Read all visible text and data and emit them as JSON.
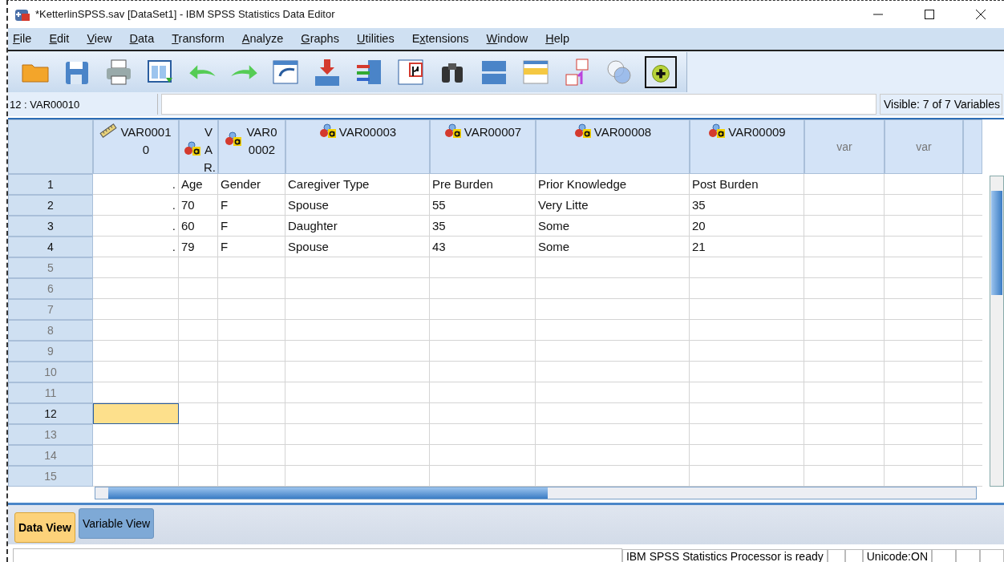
{
  "window": {
    "title": "*KetterlinSPSS.sav [DataSet1] - IBM SPSS Statistics Data Editor"
  },
  "menu": [
    {
      "mnemonic": "F",
      "rest": "ile"
    },
    {
      "mnemonic": "E",
      "rest": "dit"
    },
    {
      "mnemonic": "V",
      "rest": "iew"
    },
    {
      "mnemonic": "D",
      "rest": "ata"
    },
    {
      "mnemonic": "T",
      "rest": "ransform"
    },
    {
      "mnemonic": "A",
      "rest": "nalyze"
    },
    {
      "mnemonic": "G",
      "rest": "raphs"
    },
    {
      "mnemonic": "U",
      "rest": "tilities"
    },
    {
      "lead": "E",
      "mnemonic": "x",
      "rest": "tensions"
    },
    {
      "mnemonic": "W",
      "rest": "indow"
    },
    {
      "mnemonic": "H",
      "rest": "elp"
    }
  ],
  "cell_editor": {
    "cell_name": "12 : VAR00010",
    "visible": "Visible: 7 of 7 Variables"
  },
  "columns": [
    {
      "name": "VAR00010",
      "kind": "scale"
    },
    {
      "name": "VAR.",
      "kind": "nominal"
    },
    {
      "name": "VAR00002",
      "kind": "nominal"
    },
    {
      "name": "VAR00003",
      "kind": "nominal"
    },
    {
      "name": "VAR00007",
      "kind": "nominal"
    },
    {
      "name": "VAR00008",
      "kind": "nominal"
    },
    {
      "name": "VAR00009",
      "kind": "nominal"
    },
    {
      "name": "var",
      "kind": "empty"
    },
    {
      "name": "var",
      "kind": "empty"
    }
  ],
  "rows": [
    {
      "number": "1",
      "cells": [
        {
          "text": ".",
          "selected": false
        },
        {
          "text": "Age",
          "selected": false
        },
        {
          "text": "Gender",
          "selected": false
        },
        {
          "text": "Caregiver Type",
          "selected": false
        },
        {
          "text": "Pre Burden",
          "selected": false
        },
        {
          "text": "Prior Knowledge",
          "selected": false
        },
        {
          "text": "Post Burden",
          "selected": false
        }
      ]
    },
    {
      "number": "2",
      "cells": [
        {
          "text": ".",
          "selected": false
        },
        {
          "text": "70",
          "selected": false
        },
        {
          "text": "F",
          "selected": false
        },
        {
          "text": "Spouse",
          "selected": false
        },
        {
          "text": "55",
          "selected": false
        },
        {
          "text": "Very Litte",
          "selected": false
        },
        {
          "text": "35",
          "selected": false
        }
      ]
    },
    {
      "number": "3",
      "cells": [
        {
          "text": ".",
          "selected": false
        },
        {
          "text": "60",
          "selected": false
        },
        {
          "text": "F",
          "selected": false
        },
        {
          "text": "Daughter",
          "selected": false
        },
        {
          "text": "35",
          "selected": false
        },
        {
          "text": "Some",
          "selected": false
        },
        {
          "text": "20",
          "selected": false
        }
      ]
    },
    {
      "number": "4",
      "cells": [
        {
          "text": ".",
          "selected": false
        },
        {
          "text": "79",
          "selected": false
        },
        {
          "text": "F",
          "selected": false
        },
        {
          "text": "Spouse",
          "selected": false
        },
        {
          "text": "43",
          "selected": false
        },
        {
          "text": "Some",
          "selected": false
        },
        {
          "text": "21",
          "selected": false
        }
      ]
    },
    {
      "number": "5"
    },
    {
      "number": "6"
    },
    {
      "number": "7"
    },
    {
      "number": "8"
    },
    {
      "number": "9"
    },
    {
      "number": "10"
    },
    {
      "number": "11"
    },
    {
      "number": "12",
      "cells": [
        {
          "selected": true
        }
      ]
    },
    {
      "number": "13"
    },
    {
      "number": "14"
    },
    {
      "number": "15"
    }
  ],
  "tabs": [
    {
      "label": "Data View",
      "selected": true
    },
    {
      "label": "Variable View",
      "selected": false
    }
  ],
  "status_bar": {
    "processor": "IBM SPSS Statistics Processor is ready",
    "unicode": "Unicode:ON"
  }
}
